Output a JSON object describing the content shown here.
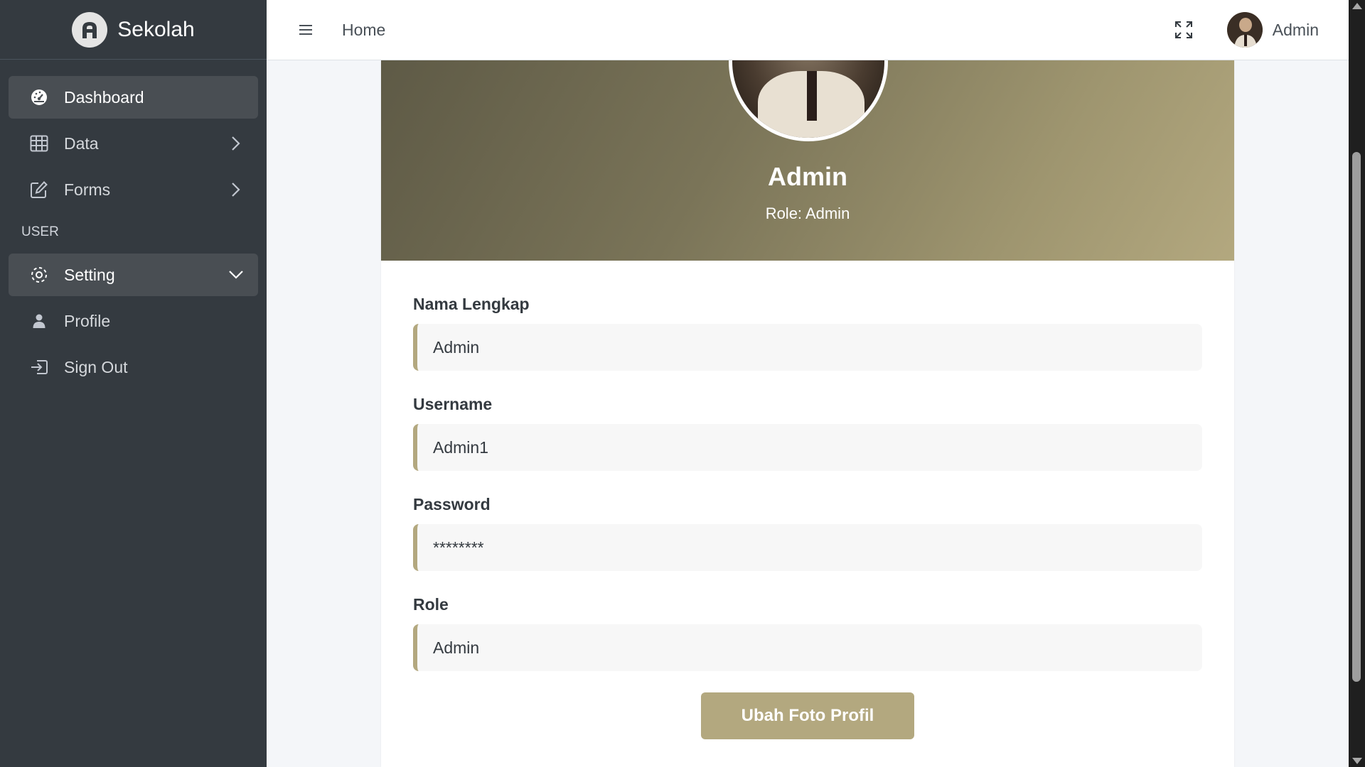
{
  "brand": {
    "name": "Sekolah"
  },
  "sidebar": {
    "items": [
      {
        "label": "Dashboard",
        "icon": "dashboard-icon",
        "active": true
      },
      {
        "label": "Data",
        "icon": "table-icon",
        "arrow": "chevron-right-icon"
      },
      {
        "label": "Forms",
        "icon": "edit-icon",
        "arrow": "chevron-right-icon"
      }
    ],
    "section_header": "USER",
    "setting": {
      "label": "Setting",
      "icon": "gear-icon",
      "arrow": "chevron-down-icon"
    },
    "sub_items": [
      {
        "label": "Profile",
        "icon": "user-icon"
      },
      {
        "label": "Sign Out",
        "icon": "sign-out-icon"
      }
    ]
  },
  "topbar": {
    "home_label": "Home",
    "user_name": "Admin"
  },
  "profile": {
    "name": "Admin",
    "role_text": "Role: Admin"
  },
  "form": {
    "fields": [
      {
        "label": "Nama Lengkap",
        "value": "Admin"
      },
      {
        "label": "Username",
        "value": "Admin1"
      },
      {
        "label": "Password",
        "value": "********"
      },
      {
        "label": "Role",
        "value": "Admin"
      }
    ],
    "button_label": "Ubah Foto Profil"
  },
  "colors": {
    "sidebar_bg": "#343a40",
    "accent": "#b3a87f"
  }
}
